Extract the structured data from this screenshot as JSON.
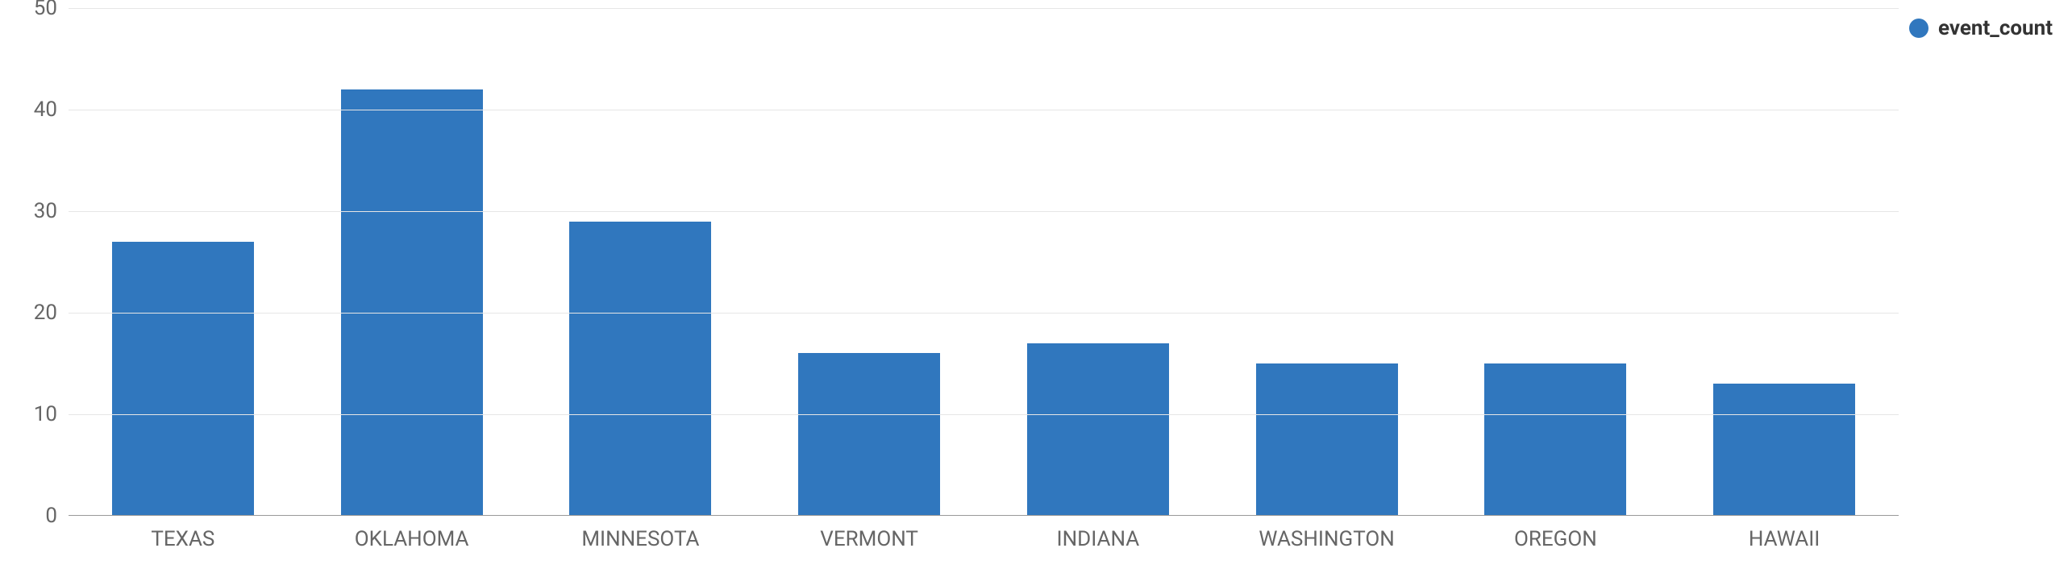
{
  "chart_data": {
    "type": "bar",
    "categories": [
      "TEXAS",
      "OKLAHOMA",
      "MINNESOTA",
      "VERMONT",
      "INDIANA",
      "WASHINGTON",
      "OREGON",
      "HAWAII"
    ],
    "series": [
      {
        "name": "event_count",
        "values": [
          27,
          42,
          29,
          16,
          17,
          15,
          15,
          13
        ]
      }
    ],
    "ylim": [
      0,
      50
    ],
    "yticks": [
      0,
      10,
      20,
      30,
      40,
      50
    ],
    "colors": {
      "event_count": "#3077be"
    },
    "title": "",
    "xlabel": "",
    "ylabel": ""
  },
  "legend": {
    "items": [
      {
        "label": "event_count",
        "color": "#3077be"
      }
    ]
  }
}
